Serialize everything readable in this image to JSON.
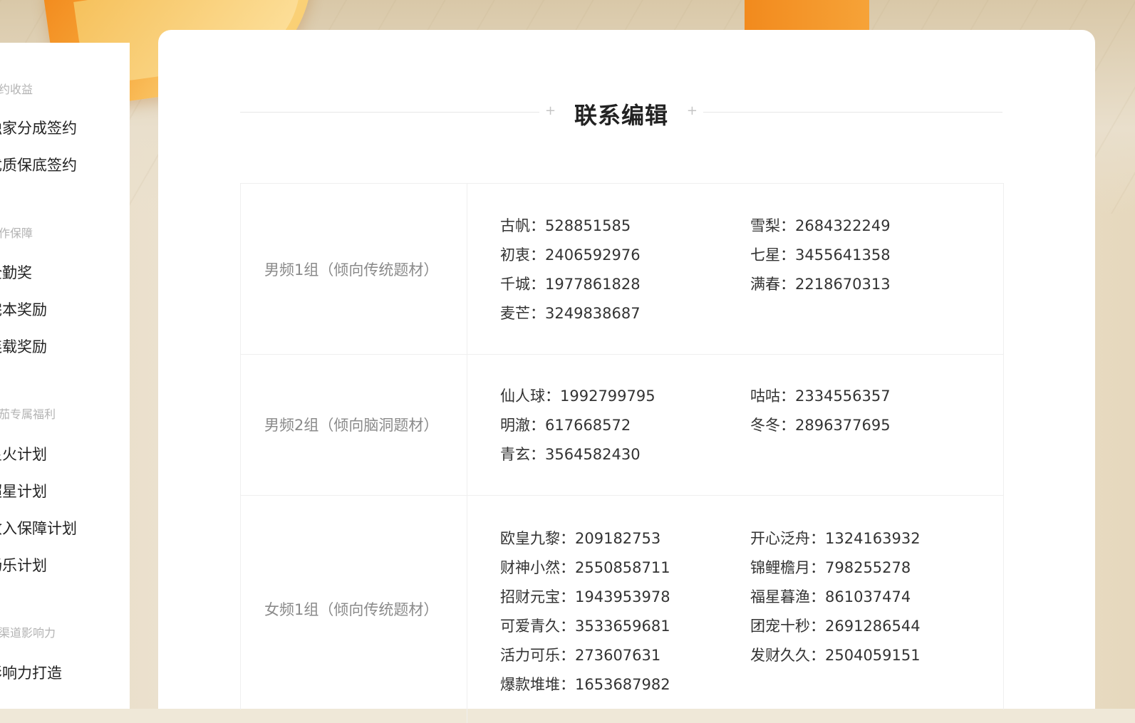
{
  "sidebar": {
    "groups": [
      {
        "heading": "签约收益",
        "items": [
          "独家分成签约",
          "优质保底签约"
        ]
      },
      {
        "heading": "创作保障",
        "items": [
          "全勤奖",
          "完本奖励",
          "连载奖励"
        ]
      },
      {
        "heading": "番茄专属福利",
        "items": [
          "星火计划",
          "超星计划",
          "收入保障计划",
          "畅乐计划"
        ]
      },
      {
        "heading": "全渠道影响力",
        "items": [
          "影响力打造"
        ]
      }
    ]
  },
  "main": {
    "title": "联系编辑",
    "title_deco": "+",
    "groups": [
      {
        "name": "男频1组（倾向传统题材）",
        "contacts": [
          [
            "古帆：528851585",
            "雪梨：2684322249"
          ],
          [
            "初衷：2406592976",
            "七星：3455641358"
          ],
          [
            "千城：1977861828",
            "满春：2218670313"
          ],
          [
            "麦芒：3249838687",
            ""
          ]
        ]
      },
      {
        "name": "男频2组（倾向脑洞题材）",
        "contacts": [
          [
            "仙人球：1992799795",
            "咕咕：2334556357"
          ],
          [
            "明澈：617668572",
            "冬冬：2896377695"
          ],
          [
            "青玄：3564582430",
            ""
          ]
        ]
      },
      {
        "name": "女频1组（倾向传统题材）",
        "contacts": [
          [
            "欧皇九黎：209182753",
            "开心泛舟：1324163932"
          ],
          [
            "财神小然：2550858711",
            "锦鲤檐月：798255278"
          ],
          [
            "招财元宝：1943953978",
            "福星暮渔：861037474"
          ],
          [
            "可爱青久：3533659681",
            "团宠十秒：2691286544"
          ],
          [
            "活力可乐：273607631",
            "发财久久：2504059151"
          ],
          [
            "爆款堆堆：1653687982",
            ""
          ]
        ]
      }
    ]
  }
}
